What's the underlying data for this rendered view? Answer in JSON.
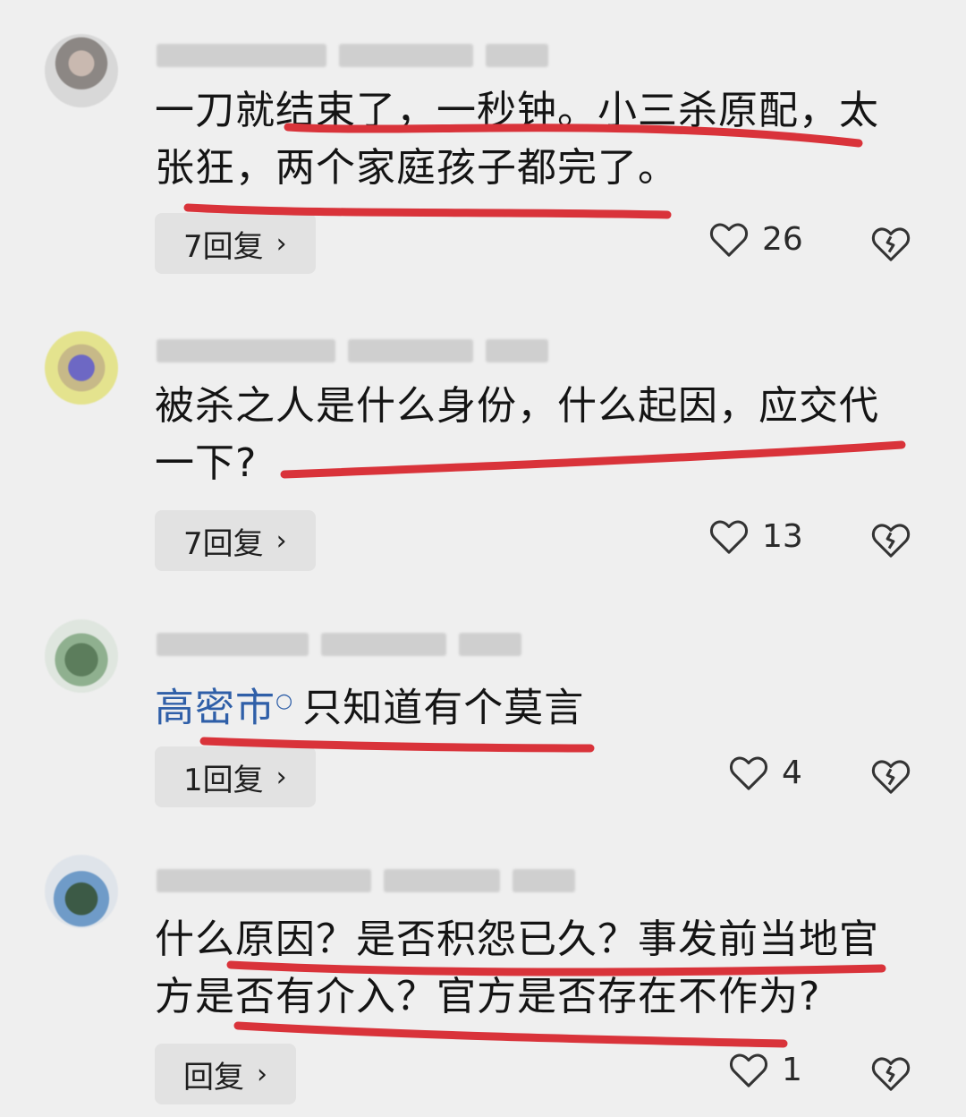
{
  "comments": [
    {
      "text_lines": [
        "一刀就结束了，一秒钟。小三杀原配，太",
        "张狂，两个家庭孩子都完了。"
      ],
      "replies_label": "7回复",
      "likes": "26"
    },
    {
      "text_lines": [
        "被杀之人是什么身份，什么起因，应交代",
        "一下?"
      ],
      "replies_label": "7回复",
      "likes": "13"
    },
    {
      "topic": "高密市",
      "text_lines": [
        "只知道有个莫言"
      ],
      "replies_label": "1回复",
      "likes": "4"
    },
    {
      "text_lines": [
        "什么原因？是否积怨已久？事发前当地官",
        "方是否有介入？官方是否存在不作为?"
      ],
      "replies_label": "回复",
      "likes": "1"
    }
  ],
  "colors": {
    "background": "#efefef",
    "underline": "#d9333a",
    "topic_link": "#2f5fa8"
  },
  "icons": [
    "heart-outline-icon",
    "broken-heart-icon",
    "chevron-right-icon",
    "search-topic-icon"
  ]
}
